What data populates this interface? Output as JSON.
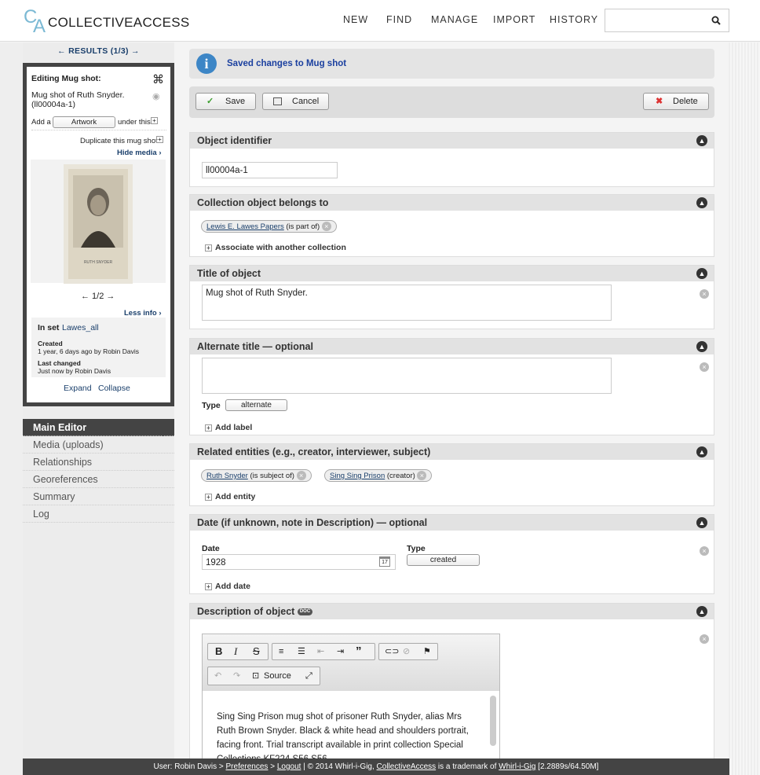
{
  "header": {
    "logo_c": "C",
    "logo_a": "A",
    "logo_text": "COLLECTIVEACCESS",
    "nav": [
      "NEW",
      "FIND",
      "MANAGE",
      "IMPORT",
      "HISTORY"
    ]
  },
  "sidebar": {
    "results": "← RESULTS (1/3) →",
    "inspector": {
      "title": "Editing Mug shot:",
      "name": "Mug shot of Ruth Snyder.",
      "ident": "(ll00004a-1)",
      "add_a": "Add a",
      "type": "Artwork",
      "under_this": "under this",
      "duplicate": "Duplicate this mug shot",
      "hide_media": "Hide media ›",
      "pager": "← 1/2 →",
      "less_info": "Less info ›",
      "in_set": "In set",
      "set_name": "Lawes_all",
      "created_label": "Created",
      "created_val": "1 year, 6 days ago by Robin Davis",
      "changed_label": "Last changed",
      "changed_val": "Just now by Robin Davis",
      "expand": "Expand",
      "collapse": "Collapse",
      "caption": "RUTH SNYDER"
    },
    "menu": [
      "Main Editor",
      "Media (uploads)",
      "Relationships",
      "Georeferences",
      "Summary",
      "Log"
    ]
  },
  "notice": "Saved changes to Mug shot",
  "toolbar": {
    "save": "Save",
    "cancel": "Cancel",
    "delete": "Delete"
  },
  "sections": {
    "identifier": {
      "title": "Object identifier",
      "value": "ll00004a-1"
    },
    "collection": {
      "title": "Collection object belongs to",
      "tag_link": "Lewis E. Lawes Papers",
      "tag_rel": "(is part of)",
      "add": "Associate with another collection"
    },
    "title": {
      "title": "Title of object",
      "value": "Mug shot of Ruth Snyder."
    },
    "alt": {
      "title": "Alternate title — optional",
      "type_label": "Type",
      "type_val": "alternate",
      "add": "Add label"
    },
    "entities": {
      "title": "Related entities (e.g., creator, interviewer, subject)",
      "e1_link": "Ruth Snyder",
      "e1_rel": "(is subject of)",
      "e2_link": "Sing Sing Prison",
      "e2_rel": "(creator)",
      "add": "Add entity"
    },
    "date": {
      "title": "Date (if unknown, note in Description) — optional",
      "date_label": "Date",
      "date_val": "1928",
      "type_label": "Type",
      "type_val": "created",
      "add": "Add date"
    },
    "desc": {
      "title": "Description of object",
      "doc": "DOC",
      "source": "Source",
      "text": "Sing Sing Prison mug shot of prisoner Ruth Snyder, alias Mrs Ruth Brown Snyder. Black & white head and shoulders portrait, facing front. Trial transcript available in print collection Special Collections KF224.S56 S56"
    }
  },
  "footer": {
    "user": "User: Robin Davis > ",
    "prefs": "Preferences",
    "sep": " > ",
    "logout": "Logout",
    "rest": " | © 2014 Whirl-i-Gig, ",
    "ca": "CollectiveAccess",
    "tm": " is a trademark of ",
    "wig": "Whirl-i-Gig",
    "stats": " [2.2889s/64.50M]"
  }
}
